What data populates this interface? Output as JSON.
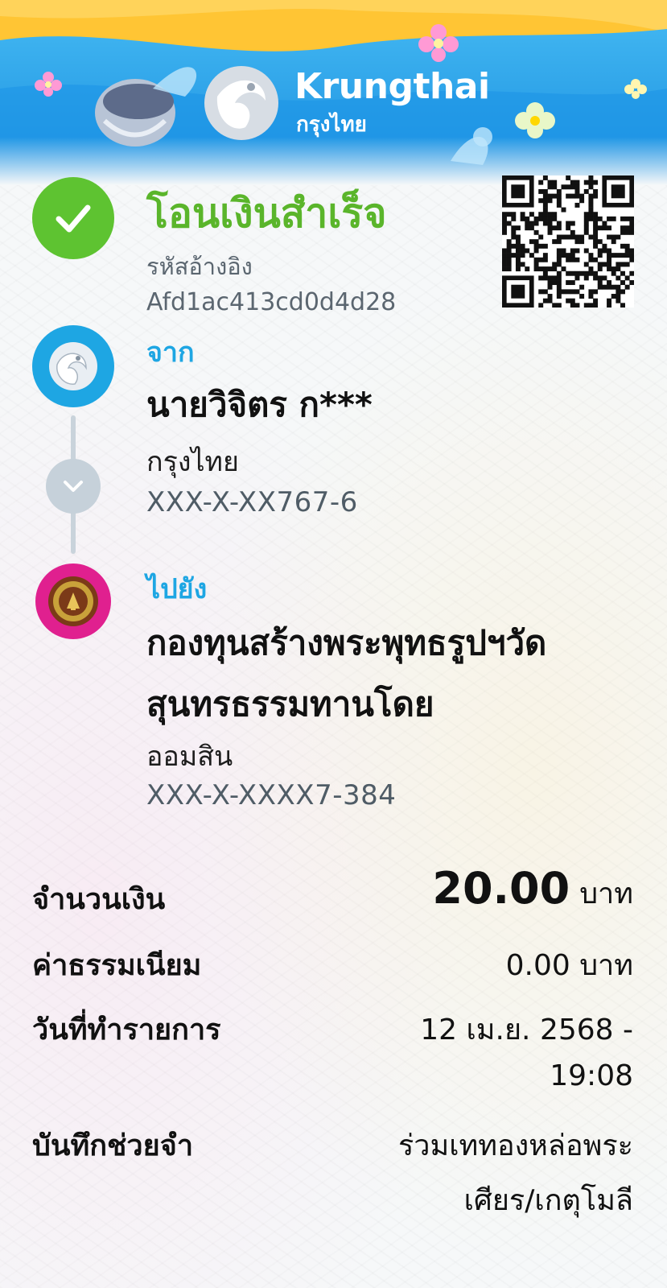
{
  "header": {
    "brand_name": "Krungthai",
    "brand_thai": "กรุงไทย"
  },
  "status": {
    "title": "โอนเงินสำเร็จ",
    "ref_label": "รหัสอ้างอิง",
    "ref_value": "Afd1ac413cd0d4d28"
  },
  "from": {
    "label": "จาก",
    "name": "นายวิจิตร ก***",
    "bank": "กรุงไทย",
    "account": "XXX-X-XX767-6"
  },
  "to": {
    "label": "ไปยัง",
    "name_line1": "กองทุนสร้างพระพุทธรูปฯวัด",
    "name_line2": "สุนทรธรรมทานโดย",
    "bank": "ออมสิน",
    "account": "XXX-X-XXXX7-384"
  },
  "details": {
    "amount_label": "จำนวนเงิน",
    "amount_value": "20.00",
    "amount_unit": "บาท",
    "fee_label": "ค่าธรรมเนียม",
    "fee_value": "0.00 บาท",
    "date_label": "วันที่ทำรายการ",
    "date_line1": "12 เม.ย. 2568 -",
    "date_line2": "19:08",
    "memo_label": "บันทึกช่วยจำ",
    "memo_line1": "ร่วมเททองหล่อพระ",
    "memo_line2": "เศียร/เกตุโมลี"
  },
  "colors": {
    "success_green": "#5ec331",
    "brand_blue": "#1ea6e3",
    "gsb_pink": "#e0208f"
  },
  "icons": {
    "status": "check-icon",
    "from_logo": "krungthai-bird-logo",
    "connector": "chevron-down-icon",
    "to_logo": "gsb-bank-logo",
    "qr": "qr-code"
  }
}
